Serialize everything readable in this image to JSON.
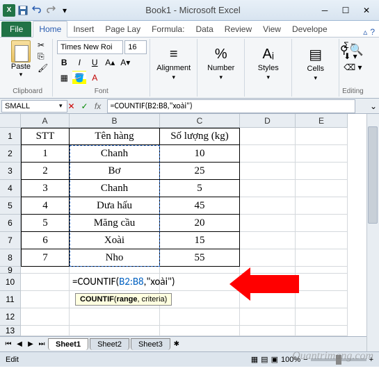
{
  "title": "Book1 - Microsoft Excel",
  "tabs": {
    "file": "File",
    "home": "Home",
    "insert": "Insert",
    "pagelayout": "Page Lay",
    "formulas": "Formula:",
    "data": "Data",
    "review": "Review",
    "view": "View",
    "developer": "Develope"
  },
  "ribbon": {
    "clipboard": {
      "paste": "Paste",
      "label": "Clipboard"
    },
    "font": {
      "name": "Times New Roi",
      "size": "16",
      "label": "Font"
    },
    "alignment": {
      "label": "Alignment"
    },
    "number": {
      "label": "Number"
    },
    "styles": {
      "label": "Styles"
    },
    "cells": {
      "label": "Cells"
    },
    "editing": {
      "label": "Editing"
    }
  },
  "namebox": "SMALL",
  "formula_bar": "=COUNTIF(B2:B8,\"xoài\")",
  "columns": [
    "A",
    "B",
    "C",
    "D",
    "E"
  ],
  "table": {
    "headers": {
      "stt": "STT",
      "tenhang": "Tên hàng",
      "soluong": "Số lượng (kg)"
    },
    "rows": [
      {
        "stt": "1",
        "tenhang": "Chanh",
        "soluong": "10"
      },
      {
        "stt": "2",
        "tenhang": "Bơ",
        "soluong": "25"
      },
      {
        "stt": "3",
        "tenhang": "Chanh",
        "soluong": "5"
      },
      {
        "stt": "4",
        "tenhang": "Dưa hấu",
        "soluong": "45"
      },
      {
        "stt": "5",
        "tenhang": "Măng cầu",
        "soluong": "20"
      },
      {
        "stt": "6",
        "tenhang": "Xoài",
        "soluong": "15"
      },
      {
        "stt": "7",
        "tenhang": "Nho",
        "soluong": "55"
      }
    ]
  },
  "formula_cell": "=COUNTIF(B2:B8,\"xoài\")",
  "tooltip": "COUNTIF(range, criteria)",
  "sheets": [
    "Sheet1",
    "Sheet2",
    "Sheet3"
  ],
  "status": "Edit",
  "zoom": "100%",
  "watermark": "Quantrimang.com"
}
